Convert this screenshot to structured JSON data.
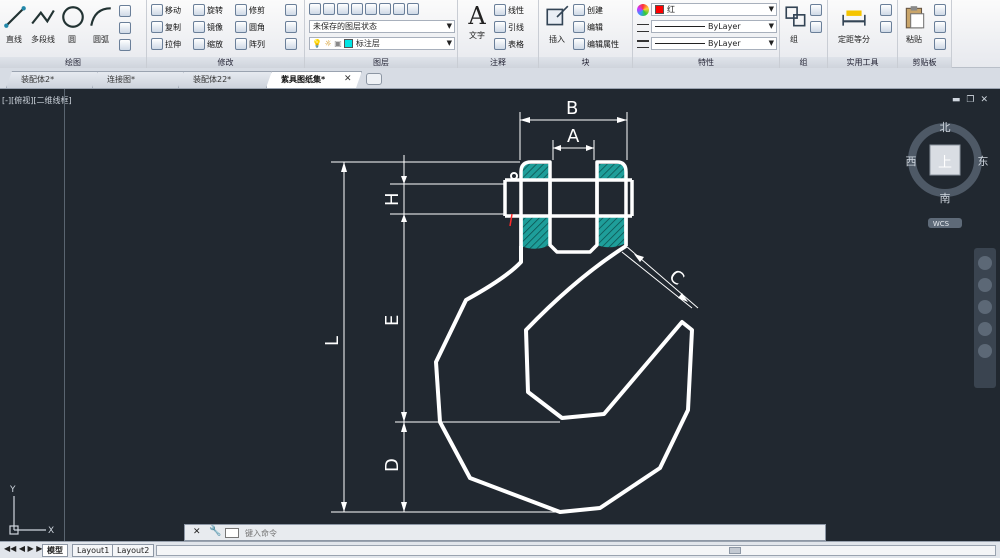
{
  "ribbon": {
    "draw": {
      "title": "绘图",
      "tools": [
        "直线",
        "多段线",
        "圆",
        "圆弧"
      ]
    },
    "modify": {
      "title": "修改",
      "tools": [
        "移动",
        "旋转",
        "修剪",
        "复制",
        "镜像",
        "圆角",
        "拉伸",
        "缩放",
        "阵列"
      ]
    },
    "layer": {
      "title": "图层",
      "state": "未保存的图层状态",
      "current": "标注层"
    },
    "annotation": {
      "title": "注释",
      "text": "文字",
      "linear": "线性",
      "leader": "引线",
      "table": "表格"
    },
    "block": {
      "title": "块",
      "insert": "插入",
      "create": "创建",
      "edit": "编辑",
      "attrs": "编辑属性"
    },
    "properties": {
      "title": "特性",
      "color": "红",
      "color_hex": "#ff0000",
      "linetype": "ByLayer",
      "lineweight": "ByLayer"
    },
    "group": {
      "title": "组",
      "label": "组"
    },
    "utilities": {
      "title": "实用工具",
      "measure": "定距等分"
    },
    "clipboard": {
      "title": "剪贴板",
      "paste": "粘贴"
    }
  },
  "tabs": [
    "装配体2*",
    "连接图*",
    "装配体22*",
    "紫具图纸集*"
  ],
  "active_tab": "紫具图纸集*",
  "viewport": {
    "label": "[-][俯视][二维线框]",
    "ucs_x": "X",
    "ucs_y": "Y"
  },
  "drawing": {
    "line_color": "#ffffff",
    "hatch_color": "#1e9e9a",
    "dims": [
      "B",
      "A",
      "C",
      "H",
      "E",
      "L",
      "D"
    ]
  },
  "viewcube": {
    "face": "上",
    "north": "北",
    "south": "南",
    "east": "东",
    "west": "西",
    "wcs": "WCS"
  },
  "command": {
    "placeholder": "键入命令"
  },
  "layout_tabs": [
    "模型",
    "Layout1",
    "Layout2"
  ]
}
